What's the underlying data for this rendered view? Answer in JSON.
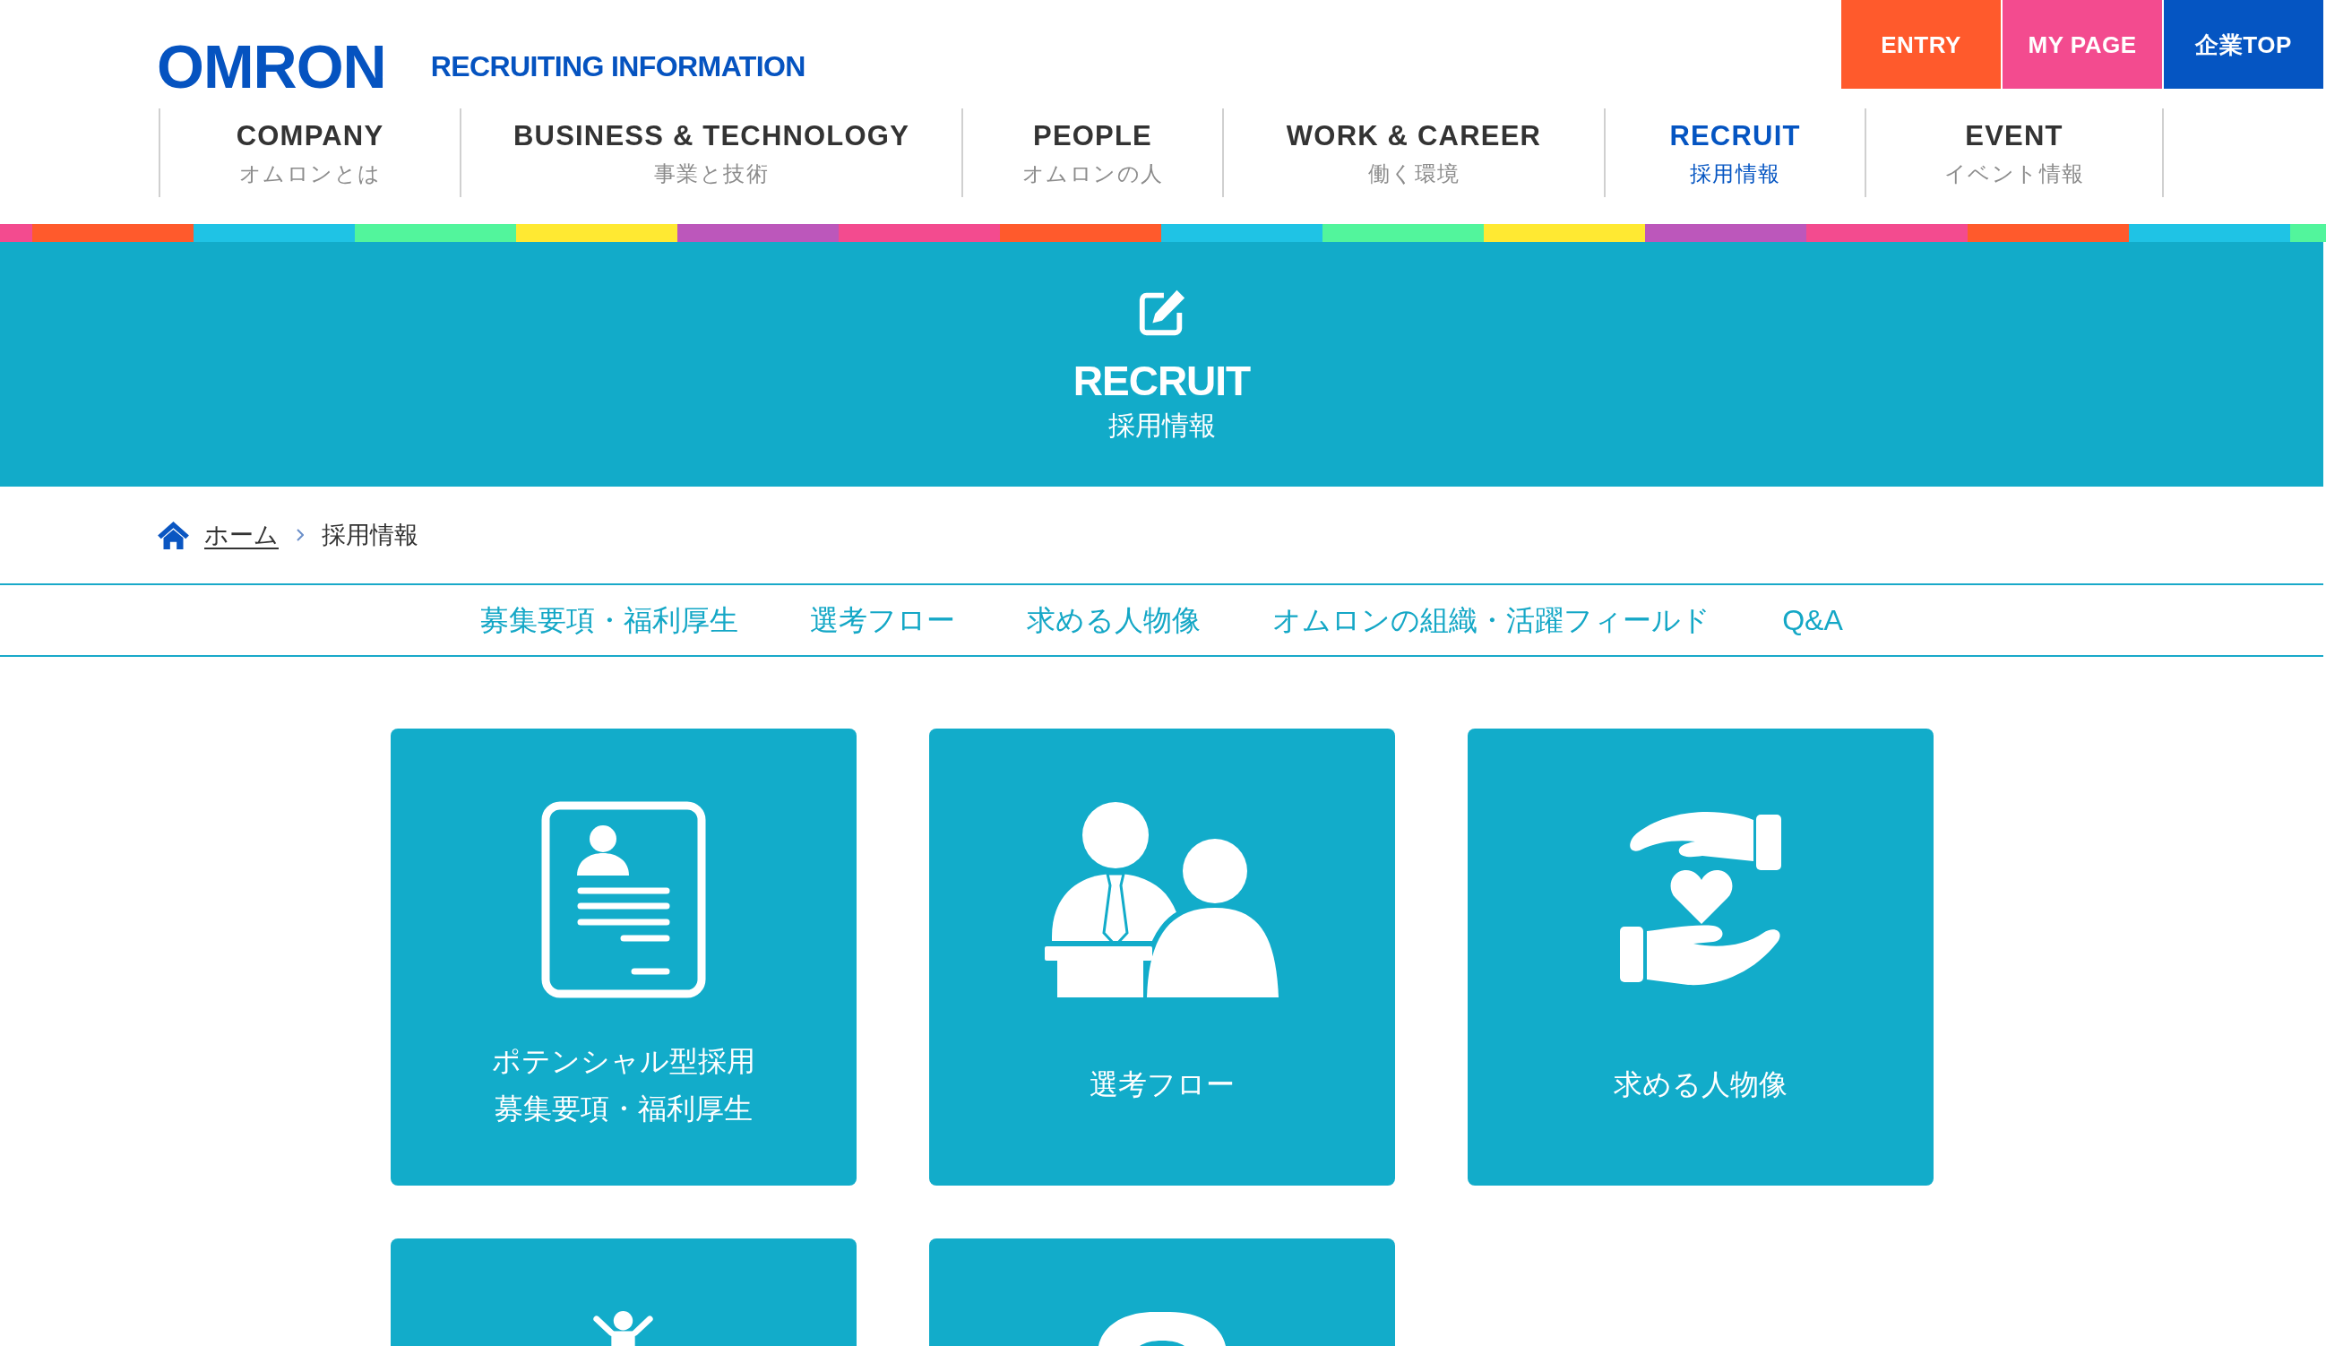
{
  "header": {
    "logo": "OMRON",
    "site_title": "RECRUITING INFORMATION",
    "top_buttons": [
      {
        "label": "ENTRY",
        "color": "#ff5a2c"
      },
      {
        "label": "MY PAGE",
        "color": "#f34b8f"
      },
      {
        "label": "企業TOP",
        "color": "#0555c2"
      }
    ]
  },
  "nav": [
    {
      "label": "COMPANY",
      "sublabel": "オムロンとは",
      "selected": false
    },
    {
      "label": "BUSINESS & TECHNOLOGY",
      "sublabel": "事業と技術",
      "selected": false
    },
    {
      "label": "PEOPLE",
      "sublabel": "オムロンの人",
      "selected": false
    },
    {
      "label": "WORK & CAREER",
      "sublabel": "働く環境",
      "selected": false
    },
    {
      "label": "RECRUIT",
      "sublabel": "採用情報",
      "selected": true
    },
    {
      "label": "EVENT",
      "sublabel": "イベント情報",
      "selected": false
    }
  ],
  "hero": {
    "title": "RECRUIT",
    "subtitle": "採用情報"
  },
  "breadcrumb": [
    {
      "label": "ホーム",
      "current": false
    },
    {
      "label": "採用情報",
      "current": true
    }
  ],
  "subnav": [
    "募集要項・福利厚生",
    "選考フロー",
    "求める人物像",
    "オムロンの組織・活躍フィールド",
    "Q&A"
  ],
  "cards": [
    {
      "kind": "full",
      "lines": [
        "ポテンシャル型採用",
        "募集要項・福利厚生"
      ]
    },
    {
      "kind": "full",
      "lines": [
        "選考フロー"
      ]
    },
    {
      "kind": "full",
      "lines": [
        "求める人物像"
      ]
    },
    {
      "kind": "cropped"
    },
    {
      "kind": "cropped"
    }
  ]
}
